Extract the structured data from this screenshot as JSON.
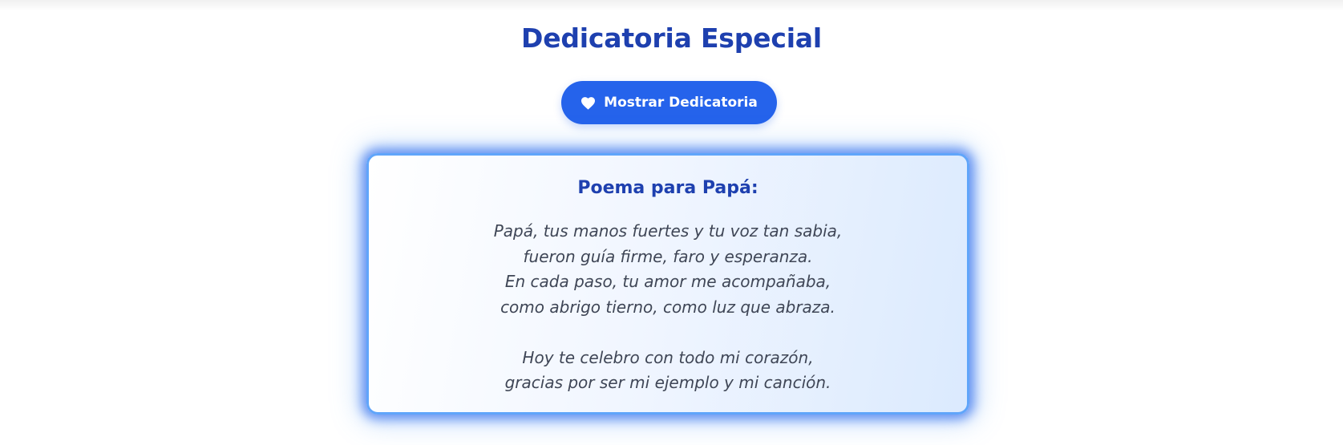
{
  "header": {
    "title": "Dedicatoria Especial"
  },
  "action": {
    "button_label": "Mostrar Dedicatoria",
    "button_icon": "heart-icon"
  },
  "card": {
    "title": "Poema para Papá:",
    "stanzas": [
      [
        "Papá, tus manos fuertes y tu voz tan sabia,",
        "fueron guía firme, faro y esperanza.",
        "En cada paso, tu amor me acompañaba,",
        "como abrigo tierno, como luz que abraza."
      ],
      [
        "Hoy te celebro con todo mi corazón,",
        "gracias por ser mi ejemplo y mi canción."
      ]
    ]
  },
  "colors": {
    "title": "#1e40af",
    "button_bg": "#2563eb",
    "button_text": "#ffffff",
    "card_border": "#60a5fa",
    "card_glow": "#2563eb",
    "poem_text": "#3f4656"
  }
}
